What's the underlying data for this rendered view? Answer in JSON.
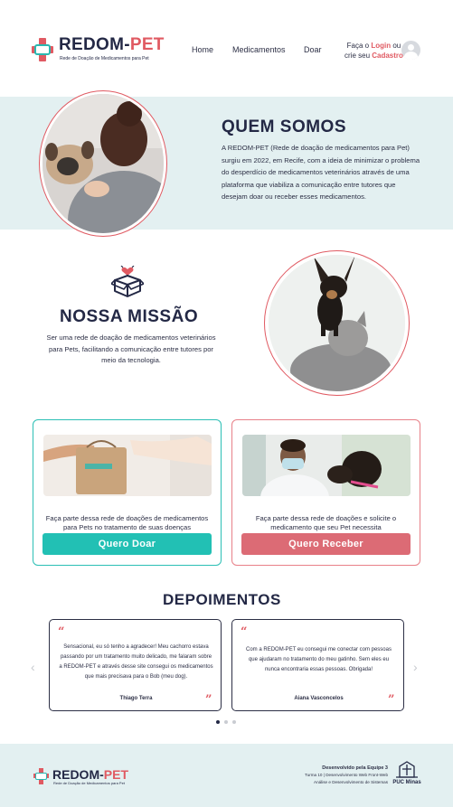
{
  "header": {
    "logo_title_main": "REDOM-",
    "logo_title_accent": "PET",
    "logo_subtitle": "Rede de Doação de Medicamentos para Pet",
    "nav": [
      "Home",
      "Medicamentos",
      "Doar"
    ],
    "login_prefix": "Faça o ",
    "login_link": "Login",
    "login_mid": " ou",
    "register_prefix": "crie seu ",
    "register_link": "Cadastro"
  },
  "about": {
    "title": "QUEM SOMOS",
    "text": "A REDOM-PET (Rede de doação de medicamentos para Pet) surgiu em 2022, em Recife, com a ideia de minimizar o problema do desperdício de medicamentos veterinários através de uma plataforma que viabiliza a comunicação entre tutores que desejam doar ou receber esses medicamentos."
  },
  "mission": {
    "title": "NOSSA MISSÃO",
    "text": "Ser uma rede de doação de medicamentos veterinários para Pets, facilitando a comunicação entre tutores por meio da tecnologia."
  },
  "cards": [
    {
      "text": "Faça parte dessa rede de doações de medicamentos para Pets no tratamento de suas doenças",
      "button": "Quero Doar"
    },
    {
      "text": "Faça parte dessa rede de doações e solicite o medicamento que seu Pet necessita",
      "button": "Quero Receber"
    }
  ],
  "testimonials": {
    "title": "DEPOIMENTOS",
    "items": [
      {
        "text": "Sensacional, eu só tenho a agradecer! Meu cachorro estava passando por um tratamento muito delicado, me falaram sobre a REDOM-PET e através desse site consegui os medicamentos que mais precisava para o Bob (meu dog).",
        "author": "Thiago Terra"
      },
      {
        "text": "Com a REDOM-PET eu consegui me conectar com pessoas que ajudaram no tratamento do meu gatinho. Sem eles eu nunca encontraria essas pessoas. Obrigada!",
        "author": "Aiana Vasconcelos"
      }
    ],
    "open_quote": "“",
    "close_quote": "”",
    "prev": "‹",
    "next": "›"
  },
  "footer": {
    "logo_title_main": "REDOM-",
    "logo_title_accent": "PET",
    "logo_subtitle": "Rede de Doação de Medicamentos para Pet",
    "credit_title": "Desenvolvido pela Equipe 3",
    "credit_line1": "Turma 10 | Desenvolvimento Web Front-Web",
    "credit_line2": "Análise e Desenvolvimento de Sistemas",
    "puc_label": "PUC Minas"
  },
  "colors": {
    "accent_red": "#e05a62",
    "accent_teal": "#22c0b4",
    "navy": "#232845",
    "band": "#e3f0f1"
  }
}
